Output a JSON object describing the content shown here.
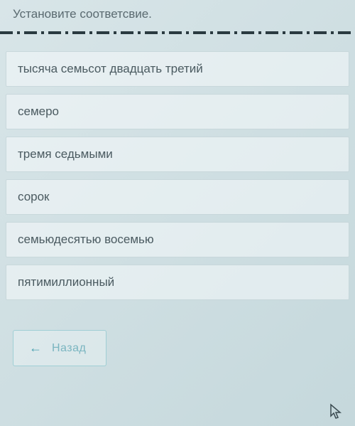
{
  "instruction": "Установите соответсвие.",
  "items": [
    {
      "label": "тысяча семьсот двадцать третий"
    },
    {
      "label": "семеро"
    },
    {
      "label": "тремя седьмыми"
    },
    {
      "label": "сорок"
    },
    {
      "label": "семьюдесятью восемью"
    },
    {
      "label": "пятимиллионный"
    }
  ],
  "back_button": {
    "label": "Назад",
    "arrow": "←"
  }
}
